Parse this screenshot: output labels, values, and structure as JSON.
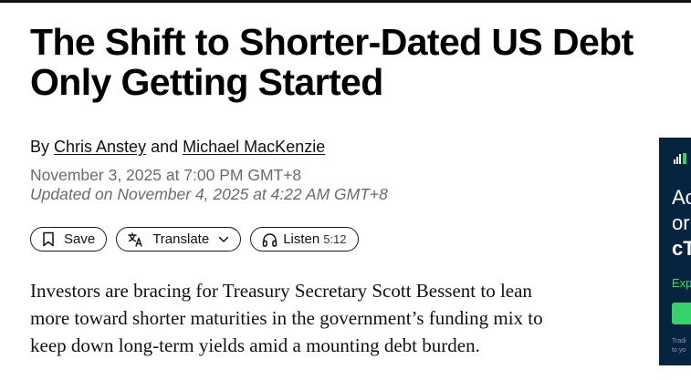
{
  "article": {
    "headline_line1": "The Shift to Shorter-Dated US Debt",
    "headline_line2": "Only Getting Started",
    "byline_prefix": "By",
    "author1": "Chris Anstey",
    "byline_and": "and",
    "author2": "Michael MacKenzie",
    "published": "November 3, 2025 at 7:00 PM GMT+8",
    "updated": "Updated on November 4, 2025 at 4:22 AM GMT+8",
    "body_line1": "Investors are bracing for Treasury Secretary Scott Bessent to lean",
    "body_line2": "more toward shorter maturities in the government’s funding mix to",
    "body_line3": "keep down long-term yields amid a mounting debt burden."
  },
  "actions": {
    "save_label": "Save",
    "translate_label": "Translate",
    "listen_label": "Listen",
    "listen_duration": "5:12"
  },
  "ad": {
    "line1": "Ac",
    "line2": "or",
    "line3": "cT",
    "sub": "Exp",
    "fine1": "Tradi",
    "fine2": "to yo",
    "colors": {
      "background": "#06243f",
      "accent": "#36d16b"
    }
  }
}
